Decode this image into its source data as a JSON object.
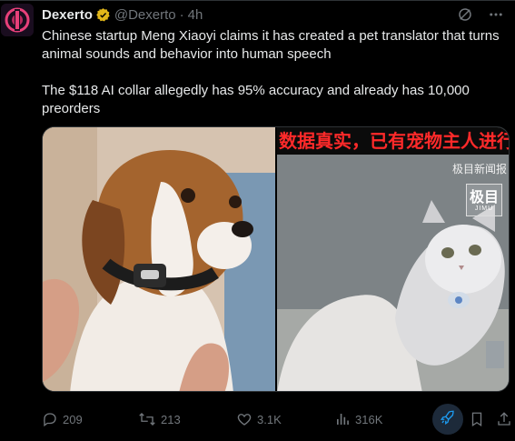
{
  "tweet": {
    "author_name": "Dexerto",
    "handle": "@Dexerto",
    "separator": "·",
    "time": "4h",
    "text": "Chinese startup Meng Xiaoyi claims it has created a pet translator that turns animal sounds and behavior into human speech\n\nThe $118 AI collar allegedly has 95% accuracy and already has 10,000 preorders"
  },
  "media": {
    "right_caption": "数据真实，已有宠物主人进行了",
    "watermark_small": "极目新闻报",
    "watermark_logo": "极目",
    "watermark_logo_sub": "JIMU"
  },
  "stats": {
    "replies": "209",
    "reposts": "213",
    "likes": "3.1K",
    "views": "316K"
  },
  "colors": {
    "background": "#000000",
    "text": "#e7e9ea",
    "muted": "#71767b",
    "verified_badge": "#e2b719",
    "caption_red": "#ff2a2a",
    "grok_bg": "#1d2a3a",
    "grok_icon": "#1d9bf0"
  },
  "icons": {
    "verified": "verified-badge-icon",
    "grok": "grok-icon",
    "more": "more-icon",
    "reply": "reply-icon",
    "repost": "repost-icon",
    "like": "heart-icon",
    "views": "views-icon",
    "boost": "rocket-icon",
    "bookmark": "bookmark-icon",
    "share": "share-icon"
  }
}
